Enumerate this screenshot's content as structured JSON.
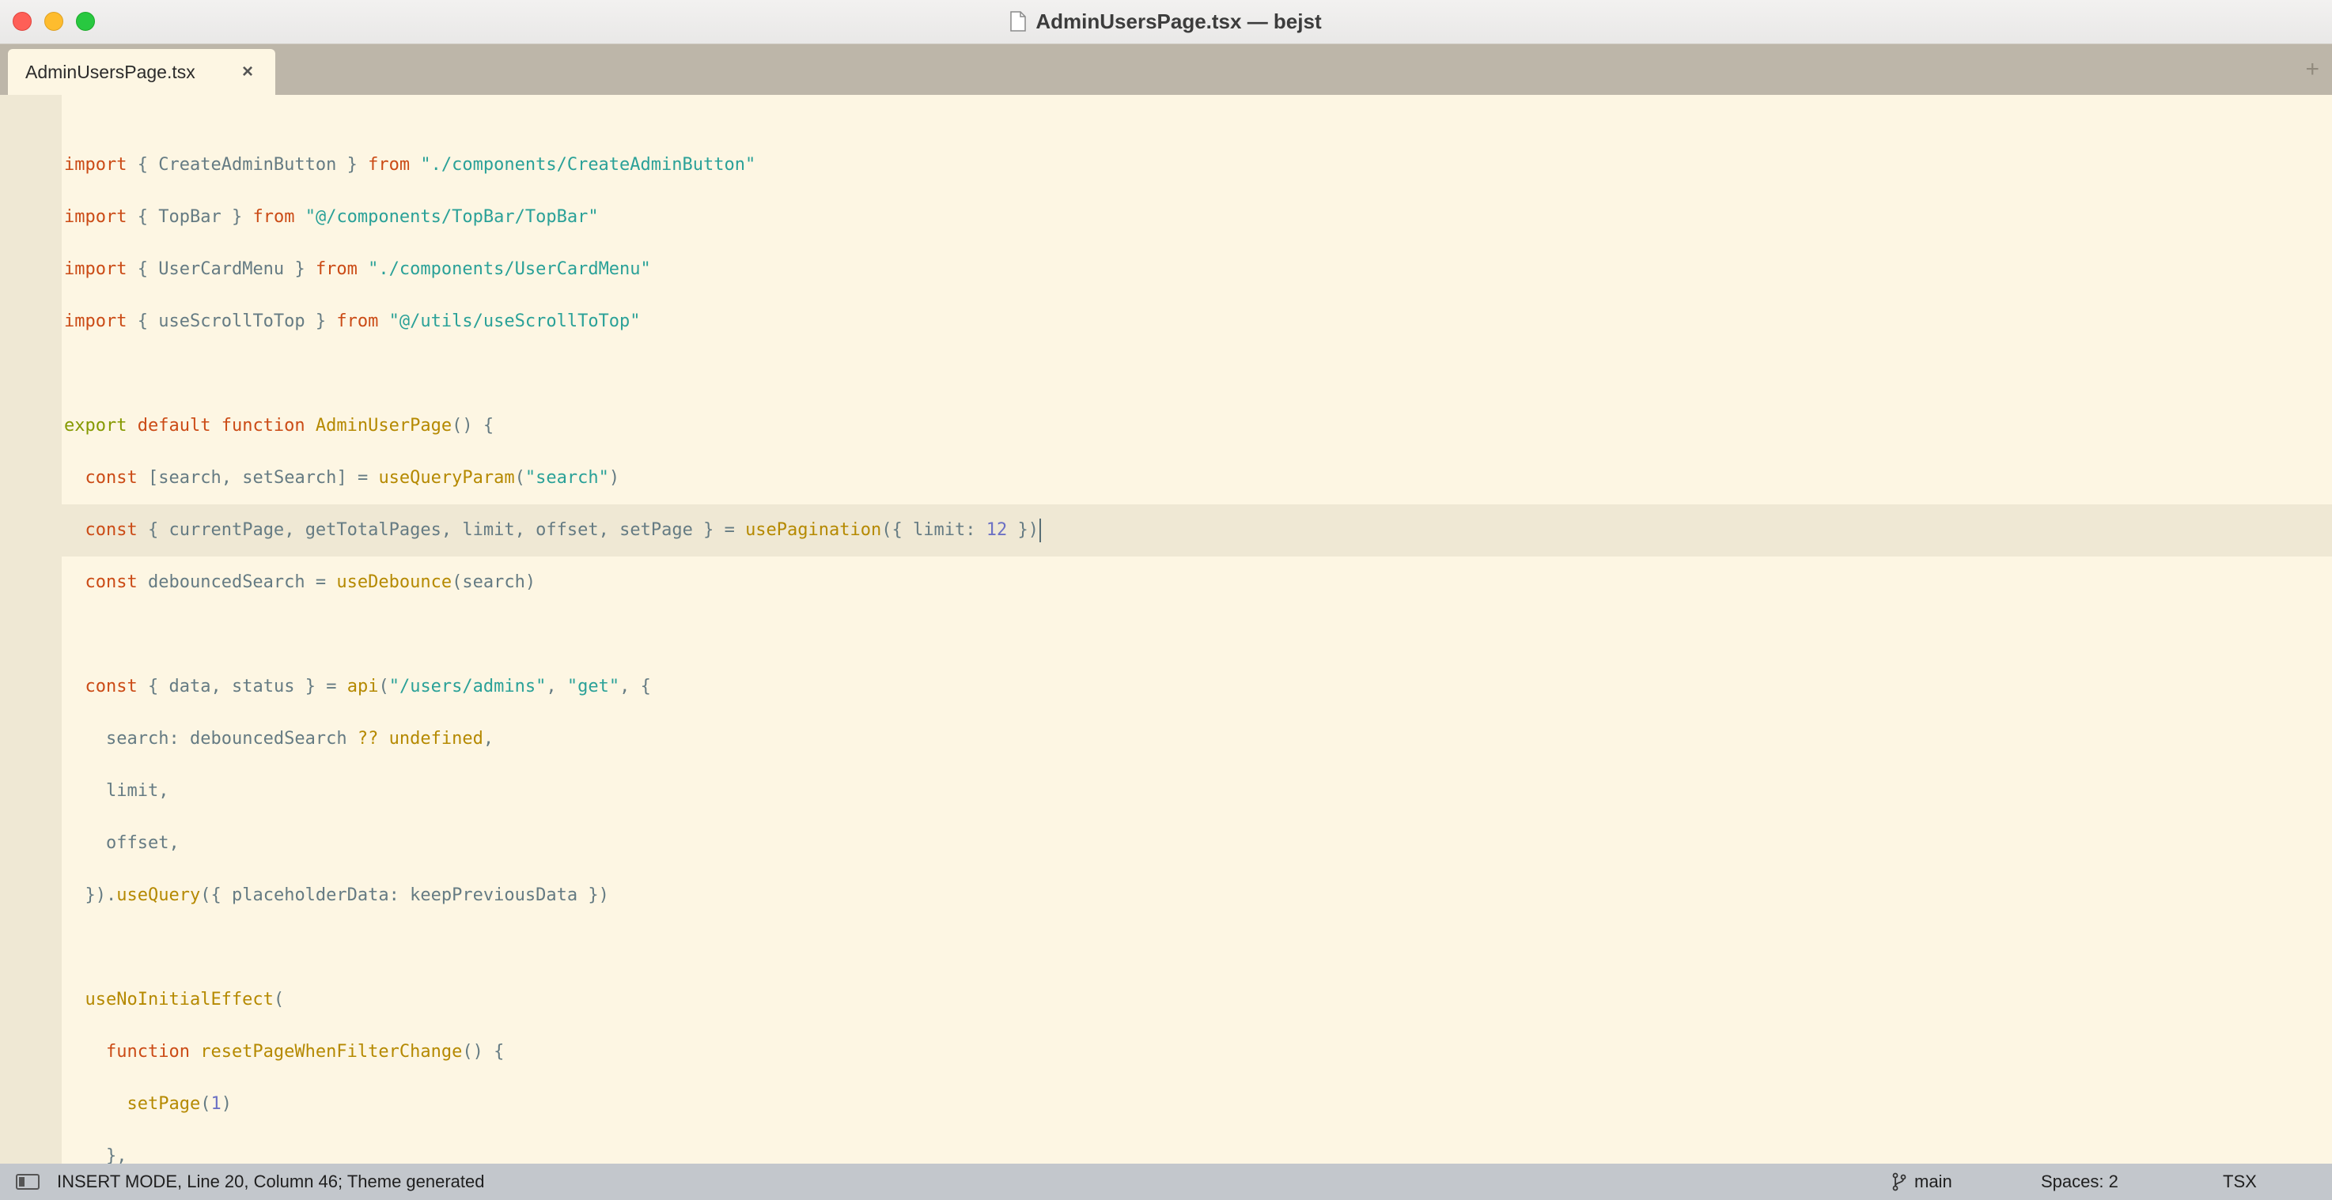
{
  "window": {
    "title": "AdminUsersPage.tsx — bejst"
  },
  "tabs": [
    {
      "label": "AdminUsersPage.tsx",
      "close": "×"
    }
  ],
  "tab_add": "+",
  "editor": {
    "current_line_index": 8,
    "lines": [
      "",
      "import { CreateAdminButton } from \"./components/CreateAdminButton\"",
      "import { TopBar } from \"@/components/TopBar/TopBar\"",
      "import { UserCardMenu } from \"./components/UserCardMenu\"",
      "import { useScrollToTop } from \"@/utils/useScrollToTop\"",
      "",
      "export default function AdminUserPage() {",
      "  const [search, setSearch] = useQueryParam(\"search\")",
      "  const { currentPage, getTotalPages, limit, offset, setPage } = usePagination({ limit: 12 })",
      "  const debouncedSearch = useDebounce(search)",
      "",
      "  const { data, status } = api(\"/users/admins\", \"get\", {",
      "    search: debouncedSearch ?? undefined,",
      "    limit,",
      "    offset,",
      "  }).useQuery({ placeholderData: keepPreviousData })",
      "",
      "  useNoInitialEffect(",
      "    function resetPageWhenFilterChange() {",
      "      setPage(1)",
      "    },",
      ""
    ]
  },
  "status_bar": {
    "mode": "INSERT MODE, Line 20, Column 46; Theme generated",
    "branch": "main",
    "spaces": "Spaces: 2",
    "syntax": "TSX"
  },
  "colors": {
    "background": "#fdf6e3",
    "keyword": "#cb4b16",
    "export": "#859900",
    "function": "#b58900",
    "string": "#2aa198",
    "number": "#6c71c4",
    "plain": "#657b83"
  }
}
